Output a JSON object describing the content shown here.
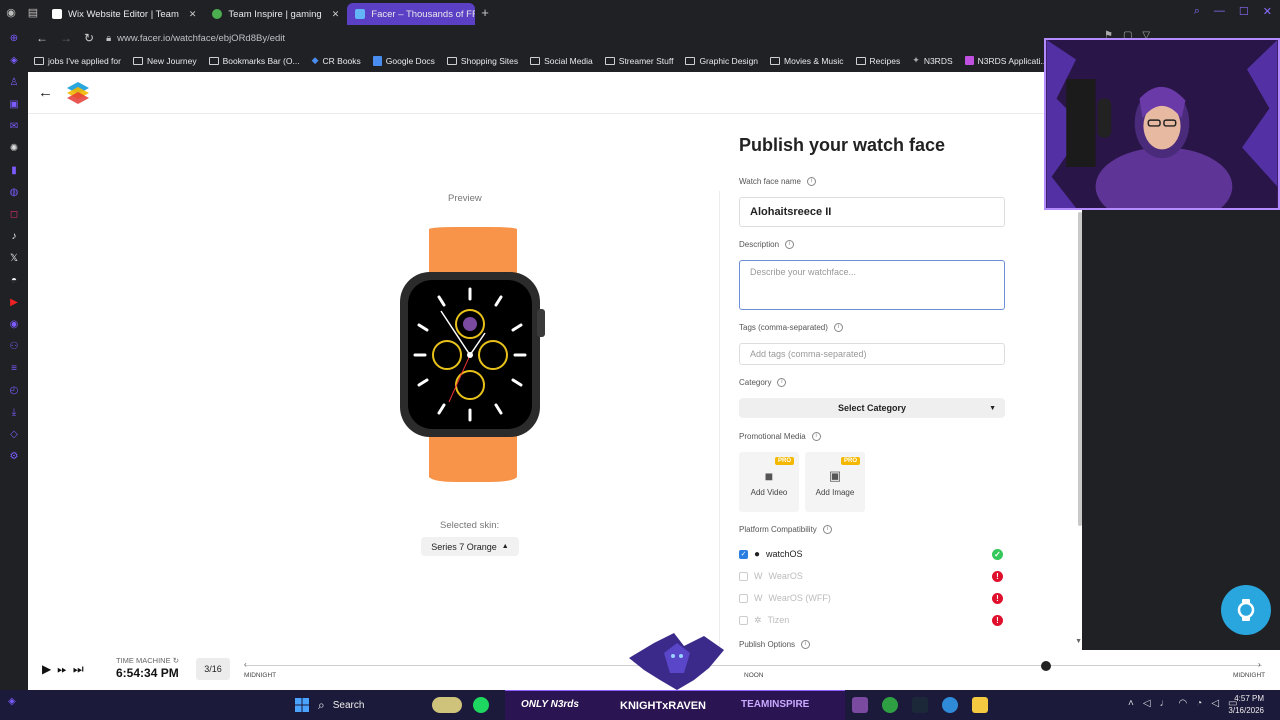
{
  "browser": {
    "tabs": [
      {
        "label": "Wix Website Editor | Team",
        "active": false,
        "color": "#ffffff"
      },
      {
        "label": "Team Inspire | gaming",
        "active": false,
        "color": "#4caf50"
      },
      {
        "label": "Facer – Thousands of FRE",
        "active": true,
        "color": "#64b5f6"
      }
    ],
    "url": "www.facer.io/watchface/ebjORd8By/edit",
    "bookmarks": [
      "jobs I've applied for",
      "New Journey",
      "Bookmarks Bar (O...",
      "CR Books",
      "Google Docs",
      "Shopping Sites",
      "Social Media",
      "Streamer Stuff",
      "Graphic Design",
      "Movies & Music",
      "Recipes",
      "N3RDS",
      "N3RDS Applicati..."
    ]
  },
  "page": {
    "preview_label": "Preview",
    "selected_skin_label": "Selected skin:",
    "selected_skin": "Series 7 Orange",
    "watch_band_color": "#f7944a",
    "form": {
      "title": "Publish your watch face",
      "name_label": "Watch face name",
      "name_value": "Alohaitsreece II",
      "description_label": "Description",
      "description_placeholder": "Describe your watchface...",
      "tags_label": "Tags (comma-separated)",
      "tags_placeholder": "Add tags (comma-separated)",
      "category_label": "Category",
      "category_value": "Select Category",
      "promo_label": "Promotional Media",
      "add_video": "Add Video",
      "add_image": "Add Image",
      "pro_badge": "PRO",
      "compat_label": "Platform Compatibility",
      "platforms": [
        {
          "name": "watchOS",
          "checked": true,
          "status": "ok"
        },
        {
          "name": "WearOS",
          "checked": false,
          "status": "error"
        },
        {
          "name": "WearOS (WFF)",
          "checked": false,
          "status": "error"
        },
        {
          "name": "Tizen",
          "checked": false,
          "status": "error"
        }
      ],
      "publish_options_label": "Publish Options"
    }
  },
  "mediabar": {
    "tm_label": "TIME MACHINE",
    "time": "6:54:34 PM",
    "count": "3/16",
    "left_label": "MIDNIGHT",
    "mid_label": "NOON",
    "right_label": "MIDNIGHT"
  },
  "taskbar": {
    "search": "Search",
    "banner_left": "ONLY N3rds",
    "banner_center": "KNIGHTxRAVEN",
    "banner_right": "TEAMINSPIRE",
    "time": "4:57 PM",
    "date": "3/16/2026"
  },
  "colors": {
    "accent": "#5b3fc4",
    "ok": "#34c759",
    "error": "#e0102c",
    "fab": "#2aa6de"
  }
}
